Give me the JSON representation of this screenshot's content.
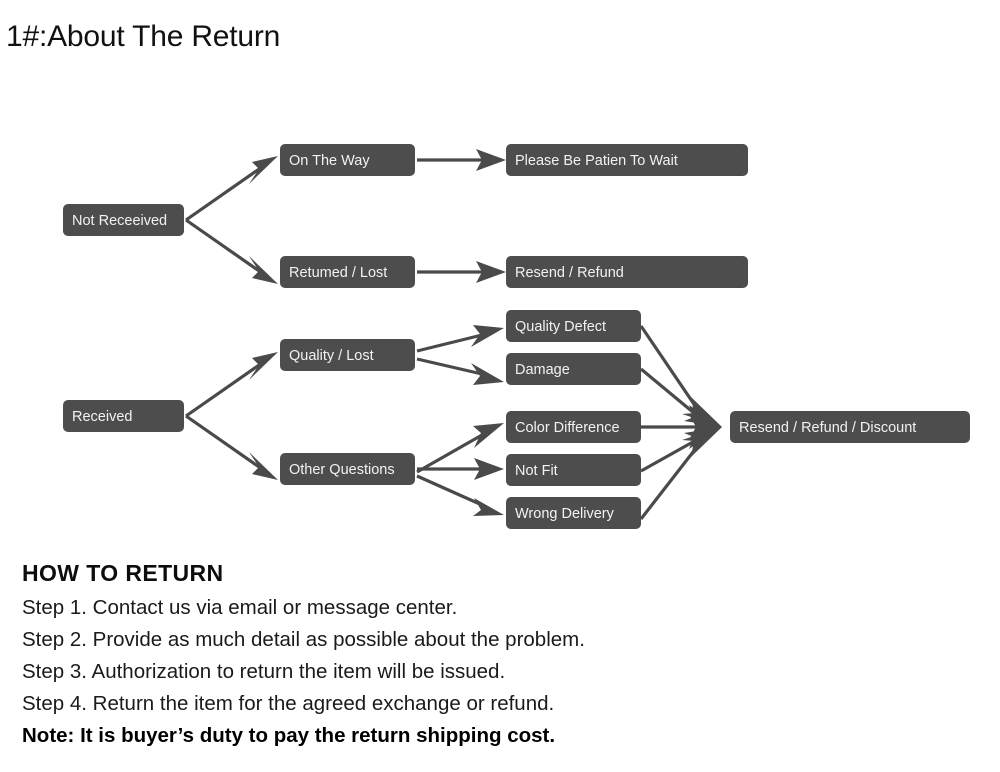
{
  "page": {
    "title": "1#:About The Return",
    "background_color": "#ffffff",
    "node_fill": "#4d4d4d",
    "node_text_color": "#f2f2f2",
    "edge_color": "#4a4a4a"
  },
  "flowchart": {
    "type": "diagram",
    "nodes": {
      "not_received": "Not Receeived",
      "on_the_way": "On The Way",
      "returned_lost": "Retumed / Lost",
      "please_wait": "Please Be Patien To Wait",
      "resend_refund": "Resend / Refund",
      "received": "Received",
      "quality_lost": "Quality / Lost",
      "other_questions": "Other Questions",
      "quality_defect": "Quality Defect",
      "damage": "Damage",
      "color_difference": "Color Difference",
      "not_fit": "Not Fit",
      "wrong_delivery": "Wrong Delivery",
      "resend_refund_discount": "Resend / Refund / Discount"
    },
    "edges": [
      {
        "from": "not_received",
        "to": "on_the_way"
      },
      {
        "from": "not_received",
        "to": "returned_lost"
      },
      {
        "from": "on_the_way",
        "to": "please_wait"
      },
      {
        "from": "returned_lost",
        "to": "resend_refund"
      },
      {
        "from": "received",
        "to": "quality_lost"
      },
      {
        "from": "received",
        "to": "other_questions"
      },
      {
        "from": "quality_lost",
        "to": "quality_defect"
      },
      {
        "from": "quality_lost",
        "to": "damage"
      },
      {
        "from": "other_questions",
        "to": "color_difference"
      },
      {
        "from": "other_questions",
        "to": "not_fit"
      },
      {
        "from": "other_questions",
        "to": "wrong_delivery"
      },
      {
        "from": "quality_defect",
        "to": "resend_refund_discount"
      },
      {
        "from": "damage",
        "to": "resend_refund_discount"
      },
      {
        "from": "color_difference",
        "to": "resend_refund_discount"
      },
      {
        "from": "not_fit",
        "to": "resend_refund_discount"
      },
      {
        "from": "wrong_delivery",
        "to": "resend_refund_discount"
      }
    ]
  },
  "howto": {
    "heading": "HOW TO RETURN",
    "steps": [
      "Step 1. Contact us via email or message center.",
      "Step 2. Provide as much detail as possible about the problem.",
      "Step 3. Authorization to return the item will be issued.",
      "Step 4. Return the item for the agreed exchange or refund."
    ],
    "note": "Note: It is buyer’s duty to pay the return shipping cost."
  }
}
